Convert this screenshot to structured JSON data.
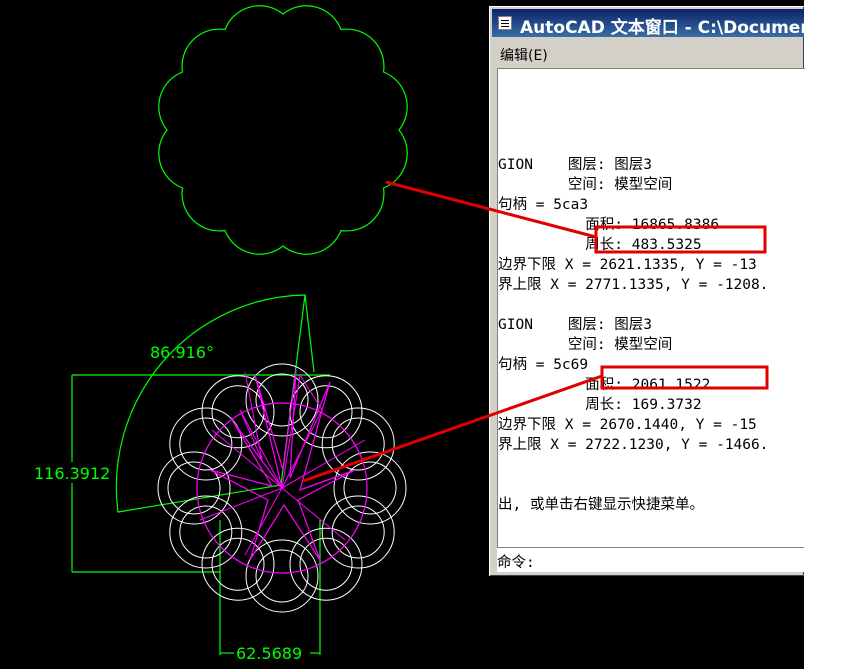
{
  "drawing": {
    "dim_angle": "86.916°",
    "dim_height": "116.3912",
    "dim_width": "62.5689"
  },
  "text_window": {
    "title": "AutoCAD 文本窗口 - C:\\Documen",
    "menu_edit": "编辑(E)",
    "lines": [
      "GION    图层: 图层3",
      "        空间: 模型空间",
      "句柄 = 5ca3",
      "          面积: 16865.8386",
      "          周长: 483.5325",
      "边界下限 X = 2621.1335, Y = -13",
      "界上限 X = 2771.1335, Y = -1208.",
      "GION    图层: 图层3",
      "        空间: 模型空间",
      "句柄 = 5c69",
      "          面积: 2061.1522",
      "          周长: 169.3732",
      "边界下限 X = 2670.1440, Y = -15",
      "界上限 X = 2722.1230, Y = -1466.",
      "出, 或单击右键显示快捷菜单。"
    ],
    "command_label": "命令:"
  },
  "colors": {
    "canvas": "#000000",
    "green": "#00ff00",
    "white": "#ffffff",
    "magenta": "#ff00ff",
    "highlight_red": "#e00000"
  }
}
